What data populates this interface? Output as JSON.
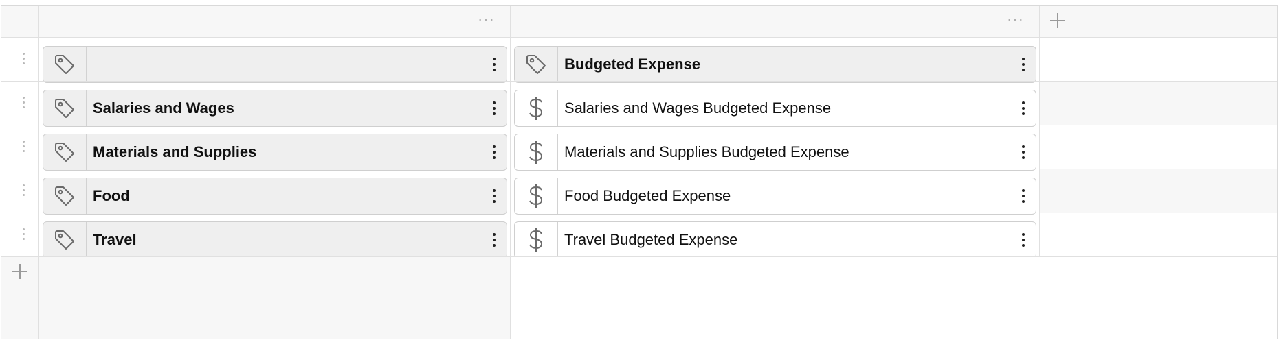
{
  "columns": {
    "left_menu": "···",
    "right_menu": "···"
  },
  "rows": [
    {
      "key": "",
      "key_icon": "tag-icon",
      "value": "Budgeted Expense",
      "value_icon": "tag-icon",
      "value_is_header": true
    },
    {
      "key": "Salaries and Wages",
      "key_icon": "tag-icon",
      "value": "Salaries and Wages Budgeted Expense",
      "value_icon": "dollar-icon",
      "value_is_header": false
    },
    {
      "key": "Materials and Supplies",
      "key_icon": "tag-icon",
      "value": "Materials and Supplies Budgeted Expense",
      "value_icon": "dollar-icon",
      "value_is_header": false
    },
    {
      "key": "Food",
      "key_icon": "tag-icon",
      "value": "Food Budgeted Expense",
      "value_icon": "dollar-icon",
      "value_is_header": false
    },
    {
      "key": "Travel",
      "key_icon": "tag-icon",
      "value": "Travel Budgeted Expense",
      "value_icon": "dollar-icon",
      "value_is_header": false
    }
  ],
  "colors": {
    "grid_border": "#d9d9d9",
    "header_bg": "#f7f7f7",
    "card_key_bg": "#efefef",
    "card_value_bg": "#ffffff",
    "icon": "#6a6a6a"
  }
}
